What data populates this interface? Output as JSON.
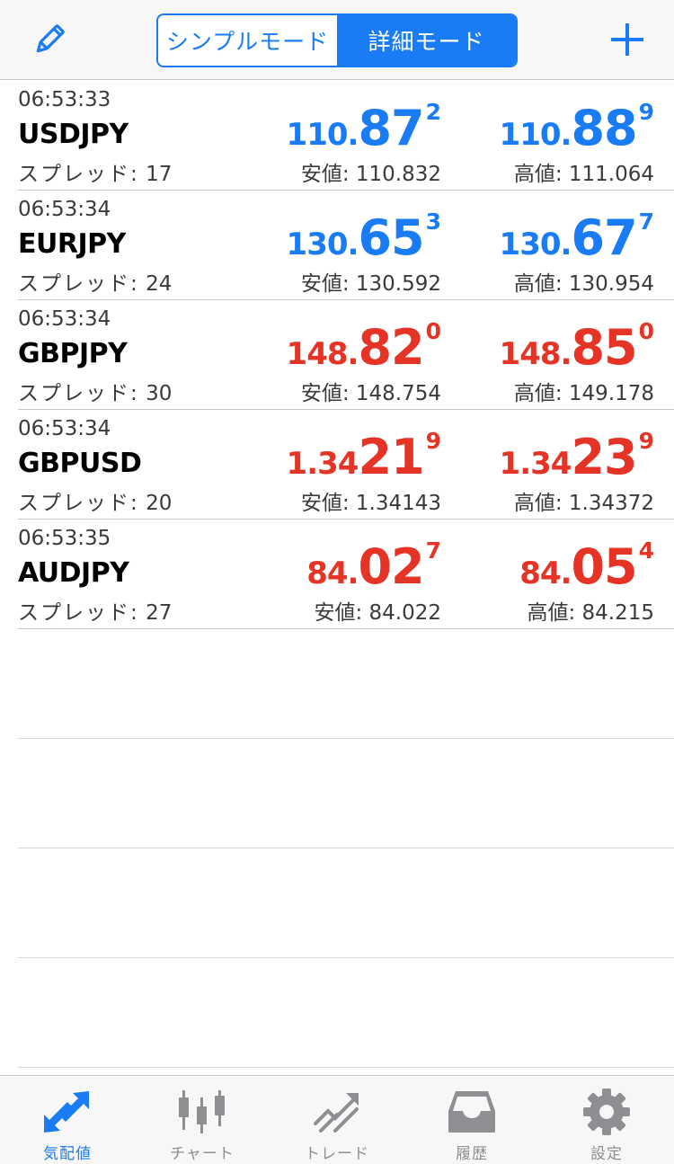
{
  "header": {
    "edit_icon": "pencil-icon",
    "add_icon": "plus-icon",
    "modes": [
      {
        "label": "シンプルモード",
        "active": false
      },
      {
        "label": "詳細モード",
        "active": true
      }
    ]
  },
  "quotes": [
    {
      "time": "06:53:33",
      "symbol": "USDJPY",
      "spread_label": "スプレッド:",
      "spread": "17",
      "bid": {
        "p1": "110.",
        "p2": "87",
        "p3": "2"
      },
      "ask": {
        "p1": "110.",
        "p2": "88",
        "p3": "9"
      },
      "direction": "up",
      "low_label": "安値:",
      "low": "110.832",
      "high_label": "高値:",
      "high": "111.064"
    },
    {
      "time": "06:53:34",
      "symbol": "EURJPY",
      "spread_label": "スプレッド:",
      "spread": "24",
      "bid": {
        "p1": "130.",
        "p2": "65",
        "p3": "3"
      },
      "ask": {
        "p1": "130.",
        "p2": "67",
        "p3": "7"
      },
      "direction": "up",
      "low_label": "安値:",
      "low": "130.592",
      "high_label": "高値:",
      "high": "130.954"
    },
    {
      "time": "06:53:34",
      "symbol": "GBPJPY",
      "spread_label": "スプレッド:",
      "spread": "30",
      "bid": {
        "p1": "148.",
        "p2": "82",
        "p3": "0"
      },
      "ask": {
        "p1": "148.",
        "p2": "85",
        "p3": "0"
      },
      "direction": "down",
      "low_label": "安値:",
      "low": "148.754",
      "high_label": "高値:",
      "high": "149.178"
    },
    {
      "time": "06:53:34",
      "symbol": "GBPUSD",
      "spread_label": "スプレッド:",
      "spread": "20",
      "bid": {
        "p1": "1.34",
        "p2": "21",
        "p3": "9"
      },
      "ask": {
        "p1": "1.34",
        "p2": "23",
        "p3": "9"
      },
      "direction": "down",
      "low_label": "安値:",
      "low": "1.34143",
      "high_label": "高値:",
      "high": "1.34372"
    },
    {
      "time": "06:53:35",
      "symbol": "AUDJPY",
      "spread_label": "スプレッド:",
      "spread": "27",
      "bid": {
        "p1": "84.",
        "p2": "02",
        "p3": "7"
      },
      "ask": {
        "p1": "84.",
        "p2": "05",
        "p3": "4"
      },
      "direction": "down",
      "low_label": "安値:",
      "low": "84.022",
      "high_label": "高値:",
      "high": "84.215"
    }
  ],
  "tabs": [
    {
      "label": "気配値",
      "icon": "quotes-arrows-icon",
      "active": true
    },
    {
      "label": "チャート",
      "icon": "candlestick-chart-icon",
      "active": false
    },
    {
      "label": "トレード",
      "icon": "trade-trend-icon",
      "active": false
    },
    {
      "label": "履歴",
      "icon": "history-inbox-icon",
      "active": false
    },
    {
      "label": "設定",
      "icon": "settings-gear-icon",
      "active": false
    }
  ],
  "colors": {
    "accent": "#1a7cf5",
    "price_up": "#1a7cf5",
    "price_down": "#e53426",
    "tab_inactive": "#8e8e93"
  }
}
